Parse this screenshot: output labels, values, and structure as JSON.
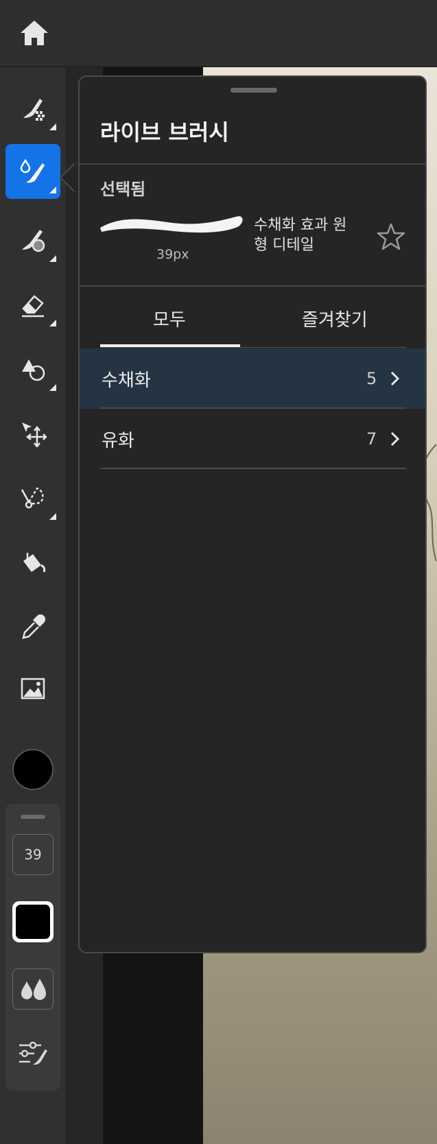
{
  "panel": {
    "title": "라이브 브러시",
    "selected_label": "선택됨",
    "brush_size": "39px",
    "brush_name": "수채화 효과 원형 디테일",
    "tabs": [
      "모두",
      "즐겨찾기"
    ],
    "active_tab": "모두",
    "categories": [
      {
        "label": "수채화",
        "count": "5",
        "selected": true
      },
      {
        "label": "유화",
        "count": "7",
        "selected": false
      }
    ]
  },
  "toolbar": {
    "tools": [
      "pixel-brush-icon",
      "live-brush-icon",
      "vector-brush-icon",
      "eraser-icon",
      "shape-icon",
      "move-transform-icon",
      "lasso-select-icon",
      "fill-bucket-icon",
      "eyedropper-icon",
      "image-icon"
    ],
    "active_tool": "live-brush-icon",
    "current_color": "#000000",
    "brush_size_value": "39"
  },
  "colors": {
    "accent": "#1473e6",
    "selected_row": "#253443",
    "panel_bg": "#252525"
  }
}
